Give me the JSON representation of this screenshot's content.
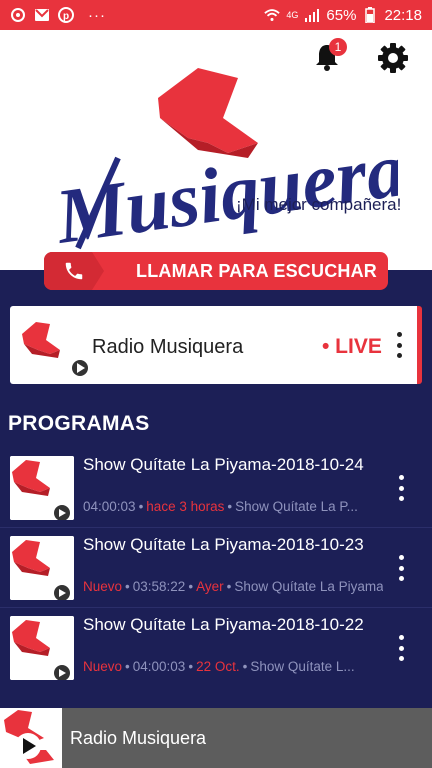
{
  "status_bar": {
    "battery": "65%",
    "time": "22:18",
    "network": "4G",
    "more": "···"
  },
  "header": {
    "brand": "Musiquera",
    "tagline": "¡Mi mejor compañera!",
    "notification_count": "1"
  },
  "call_bar": {
    "label": "LLAMAR PARA ESCUCHAR"
  },
  "live_station": {
    "title": "Radio Musiquera",
    "live_label": "• LIVE"
  },
  "section": {
    "title": "PROGRAMAS"
  },
  "programs": [
    {
      "title": "Show Quítate La Piyama-2018-10-24",
      "status": "",
      "duration": "04:00:03",
      "date": "hace 3 horas",
      "show": "Show Quítate La P..."
    },
    {
      "title": "Show Quítate La Piyama-2018-10-23",
      "status": "Nuevo",
      "duration": "03:58:22",
      "date": "Ayer",
      "show": "Show Quítate La Piyama..."
    },
    {
      "title": "Show Quítate La Piyama-2018-10-22",
      "status": "Nuevo",
      "duration": "04:00:03",
      "date": "22 Oct.",
      "show": "Show Quítate L..."
    }
  ],
  "player": {
    "title": "Radio Musiquera"
  },
  "colors": {
    "primary_red": "#e8333d",
    "navy": "#1c1f56",
    "player_gray": "#5d5d5d"
  }
}
